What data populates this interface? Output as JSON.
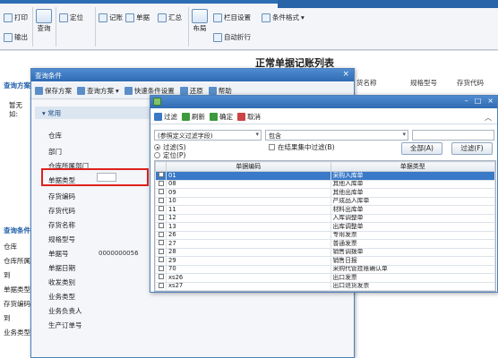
{
  "ribbon": {
    "print": "打印",
    "output": "输出",
    "query": "查询",
    "locate": "定位",
    "posting": "记账",
    "document": "单据",
    "summary": "汇总",
    "layout": "布局",
    "column_settings": "栏目设置",
    "condition_format": "条件格式",
    "auto_wrap": "自动折行"
  },
  "page": {
    "title": "正常单据记账列表",
    "col_headers": [
      "货名称",
      "规格型号",
      "存货代码"
    ],
    "left_labels": [
      "查询方案",
      "暂无",
      "如:",
      "",
      "查询条件",
      "仓库",
      "仓库所属",
      "到",
      "单据类型",
      "存货编码",
      "到",
      "业务类型"
    ]
  },
  "query_dialog": {
    "title": "查询条件",
    "tools": [
      "保存方案",
      "查询方案",
      "快速条件设置",
      "还原",
      "帮助"
    ],
    "section": "常用",
    "rows": [
      {
        "label": "仓库",
        "value": ""
      },
      {
        "label": "部门",
        "value": ""
      },
      {
        "label": "仓库所属部门",
        "value": ""
      },
      {
        "label": "单据类型",
        "value": ""
      },
      {
        "label": "存货编码",
        "value": ""
      },
      {
        "label": "存货代码",
        "value": ""
      },
      {
        "label": "存货名称",
        "value": ""
      },
      {
        "label": "规格型号",
        "value": ""
      },
      {
        "label": "单据号",
        "value": "0000000056"
      },
      {
        "label": "单据日期",
        "value": ""
      },
      {
        "label": "收发类别",
        "value": ""
      },
      {
        "label": "业务类型",
        "value": ""
      },
      {
        "label": "业务负责人",
        "value": ""
      },
      {
        "label": "生产订单号",
        "value": ""
      }
    ]
  },
  "filter_dialog": {
    "tools": [
      "过滤",
      "刷新",
      "确定",
      "取消"
    ],
    "field_select": "(参照定义过滤字段)",
    "op_select": "包含",
    "radio_filter": "过滤(S)",
    "radio_locate": "定位(P)",
    "check_in_result": "在结果集中过滤(B)",
    "btn_all": "全部(A)",
    "btn_filter": "过滤(F)",
    "grid_headers": [
      "单据编码",
      "单据类型"
    ],
    "rows": [
      {
        "code": "01",
        "type": "采购入库单"
      },
      {
        "code": "08",
        "type": "其他入库单"
      },
      {
        "code": "09",
        "type": "其他出库单"
      },
      {
        "code": "10",
        "type": "产成品入库单"
      },
      {
        "code": "11",
        "type": "材料出库单"
      },
      {
        "code": "12",
        "type": "入库调整单"
      },
      {
        "code": "13",
        "type": "出库调整单"
      },
      {
        "code": "26",
        "type": "专用发票"
      },
      {
        "code": "27",
        "type": "普通发票"
      },
      {
        "code": "28",
        "type": "销售调拨单"
      },
      {
        "code": "29",
        "type": "销售日报"
      },
      {
        "code": "70",
        "type": "采购代管挂账确认单"
      },
      {
        "code": "xs26",
        "type": "出口发票"
      },
      {
        "code": "xs27",
        "type": "出口退货发票"
      }
    ]
  },
  "colors": {
    "accent_blue": "#2f6bb2",
    "selected_row": "#3a79c8",
    "highlight_red": "#e0201c"
  }
}
